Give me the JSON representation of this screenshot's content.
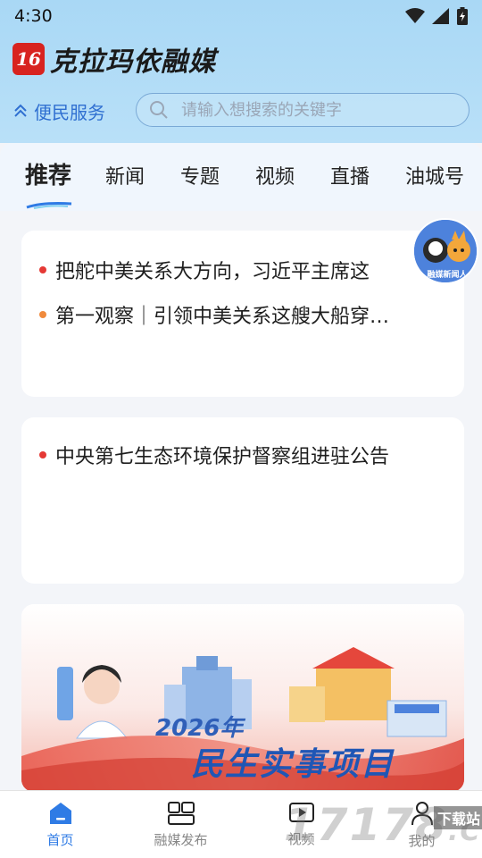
{
  "status_bar": {
    "time": "4:30",
    "icons": [
      "wifi-icon",
      "signal-icon",
      "battery-icon"
    ]
  },
  "header": {
    "logo_text": "16",
    "app_name": "克拉玛依融媒",
    "service_label": "便民服务",
    "search_placeholder": "请输入想搜索的关键字"
  },
  "tabs": [
    {
      "label": "推荐",
      "active": true
    },
    {
      "label": "新闻",
      "active": false
    },
    {
      "label": "专题",
      "active": false
    },
    {
      "label": "视频",
      "active": false
    },
    {
      "label": "直播",
      "active": false
    },
    {
      "label": "油城号",
      "active": false
    }
  ],
  "cards": [
    {
      "items": [
        {
          "text": "把舵中美关系大方向，习近平主席这",
          "dot_color": "#e53935"
        },
        {
          "text": "第一观察｜引领中美关系这艘大船穿…",
          "dot_color": "#f08a3c"
        }
      ]
    },
    {
      "items": [
        {
          "text": "中央第七生态环境保护督察组进驻公告",
          "dot_color": "#e53935"
        }
      ]
    }
  ],
  "floating_badge": {
    "label": "融媒新闻人"
  },
  "banner": {
    "year_text": "2026年",
    "title": "民生实事项目"
  },
  "bottom_nav": [
    {
      "label": "首页",
      "icon": "home-icon",
      "active": true
    },
    {
      "label": "融媒发布",
      "icon": "grid-icon",
      "active": false
    },
    {
      "label": "视频",
      "icon": "play-icon",
      "active": false
    },
    {
      "label": "我的",
      "icon": "user-icon",
      "active": false
    }
  ],
  "watermark": {
    "text": "17178",
    "suffix": ".COM",
    "badge": "下载站"
  },
  "colors": {
    "accent": "#2f7be5",
    "header_bg": "#a9d8f5",
    "service_blue": "#2f6fd1",
    "logo_red": "#d8231f"
  }
}
